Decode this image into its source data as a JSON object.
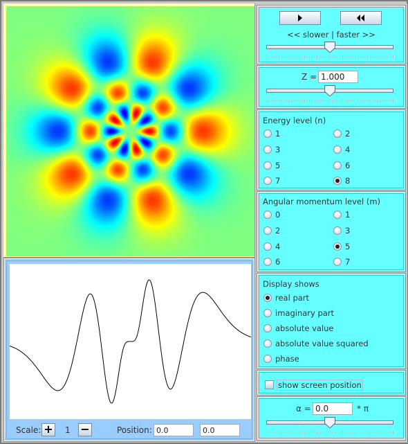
{
  "simulation": {
    "energy_level_n": 8,
    "angular_momentum_m": 5,
    "Z": 1.0,
    "alpha_times_pi": 0.0,
    "display_mode": "real part",
    "colormap": "jet",
    "background_color": "#80ff80"
  },
  "animation": {
    "play_icon": "play-icon",
    "rewind_icon": "rewind-icon",
    "speed_label": "<< slower | faster >>",
    "speed_slider_value": 0.5
  },
  "z_control": {
    "label": "Z =",
    "value": "1.000",
    "slider_value": 0.5
  },
  "energy": {
    "title": "Energy level (n)",
    "options": [
      "1",
      "2",
      "3",
      "4",
      "5",
      "6",
      "7",
      "8"
    ],
    "selected": "8"
  },
  "angular": {
    "title": "Angular momentum level (m)",
    "options": [
      "0",
      "1",
      "2",
      "3",
      "4",
      "5",
      "6",
      "7"
    ],
    "selected": "5"
  },
  "display": {
    "title": "Display shows",
    "options": [
      "real part",
      "imaginary part",
      "absolute value",
      "absolute value squared",
      "phase"
    ],
    "selected": "real part"
  },
  "screen_position": {
    "label": "show screen position",
    "checked": false
  },
  "alpha_control": {
    "label": "α =",
    "value": "0.0",
    "suffix": "* π",
    "slider_value": 0.5
  },
  "plot_controls": {
    "scale_label": "Scale:",
    "scale_plus": "+",
    "scale_value": "1",
    "scale_minus": "−",
    "position_label": "Position:",
    "position_x": "0.0",
    "position_y": "0.0"
  },
  "colors": {
    "panel_cyan": "#66ffff",
    "image_frame_yellow": "#ffffa0",
    "plot_panel_blue": "#99ccff"
  }
}
